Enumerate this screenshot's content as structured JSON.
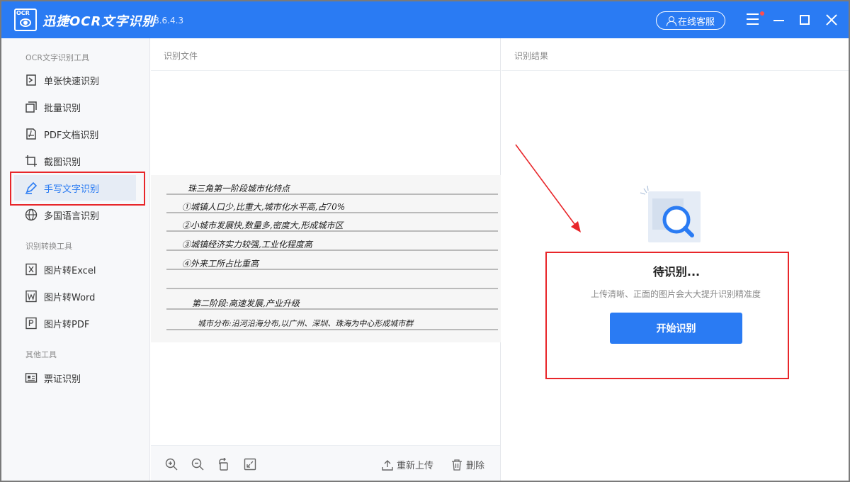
{
  "titlebar": {
    "logo_text": "OCR",
    "app_name": "迅捷OCR文字识别",
    "version": "v8.6.4.3",
    "service_label": "在线客服"
  },
  "sidebar": {
    "sections": [
      {
        "label": "OCR文字识别工具",
        "items": [
          "单张快速识别",
          "批量识别",
          "PDF文档识别",
          "截图识别",
          "手写文字识别",
          "多国语言识别"
        ]
      },
      {
        "label": "识别转换工具",
        "items": [
          "图片转Excel",
          "图片转Word",
          "图片转PDF"
        ]
      },
      {
        "label": "其他工具",
        "items": [
          "票证识别"
        ]
      }
    ],
    "active_item": "手写文字识别"
  },
  "file_panel": {
    "header": "识别文件",
    "handwriting_lines": [
      "珠三角第一阶段城市化特点",
      "①城镇人口少,比重大,城市化水平高,占70%",
      "②小城市发展快,数量多,密度大,形成城市区",
      "③城镇经济实力较强,工业化程度高",
      "④外来工所占比重高",
      "",
      "第二阶段:高速发展,产业升级",
      "城市分布:沿河沿海分布,以广州、深圳、珠海为中心形成城市群"
    ],
    "reupload_label": "重新上传",
    "delete_label": "删除"
  },
  "result_panel": {
    "header": "识别结果",
    "status_title": "待识别...",
    "hint": "上传清晰、正面的图片会大大提升识别精准度",
    "start_button": "开始识别"
  },
  "colors": {
    "accent": "#2a7bf3",
    "highlight": "#e8262a"
  },
  "icons": [
    "ocr-logo-icon",
    "person-icon",
    "menu-icon",
    "minimize-icon",
    "maximize-icon",
    "close-icon",
    "zoom-in-icon",
    "zoom-out-icon",
    "rotate-icon",
    "fit-icon",
    "upload-icon",
    "trash-icon",
    "magnifier-icon"
  ]
}
